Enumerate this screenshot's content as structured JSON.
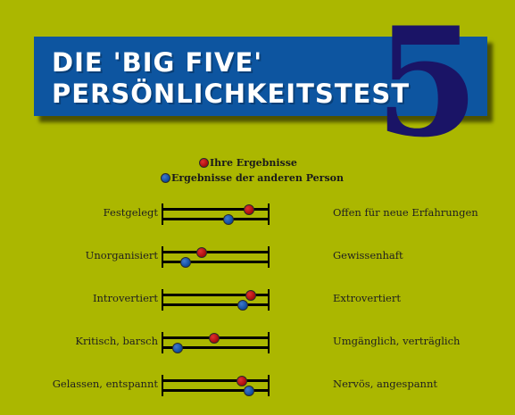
{
  "header": {
    "title_line1": "DIE 'BIG FIVE'",
    "title_line2": "PERSÖNLICHKEITSTEST",
    "big_digit": "5"
  },
  "legend": {
    "own": "Ihre Ergebnisse",
    "other": "Ergebnisse der anderen Person"
  },
  "colors": {
    "background": "#abb700",
    "banner": "#0d55a0",
    "digit": "#1a1466",
    "own_dot": "#c01414",
    "other_dot": "#1a5cb8"
  },
  "traits": [
    {
      "left": "Festgelegt",
      "right": "Offen für neue Erfahrungen",
      "own": 0.81,
      "other": 0.62
    },
    {
      "left": "Unorganisiert",
      "right": "Gewissenhaft",
      "own": 0.37,
      "other": 0.22
    },
    {
      "left": "Introvertiert",
      "right": "Extrovertiert",
      "own": 0.83,
      "other": 0.75
    },
    {
      "left": "Kritisch, barsch",
      "right": "Umgänglich, verträglich",
      "own": 0.49,
      "other": 0.15
    },
    {
      "left": "Gelassen, entspannt",
      "right": "Nervös, angespannt",
      "own": 0.74,
      "other": 0.81
    }
  ]
}
